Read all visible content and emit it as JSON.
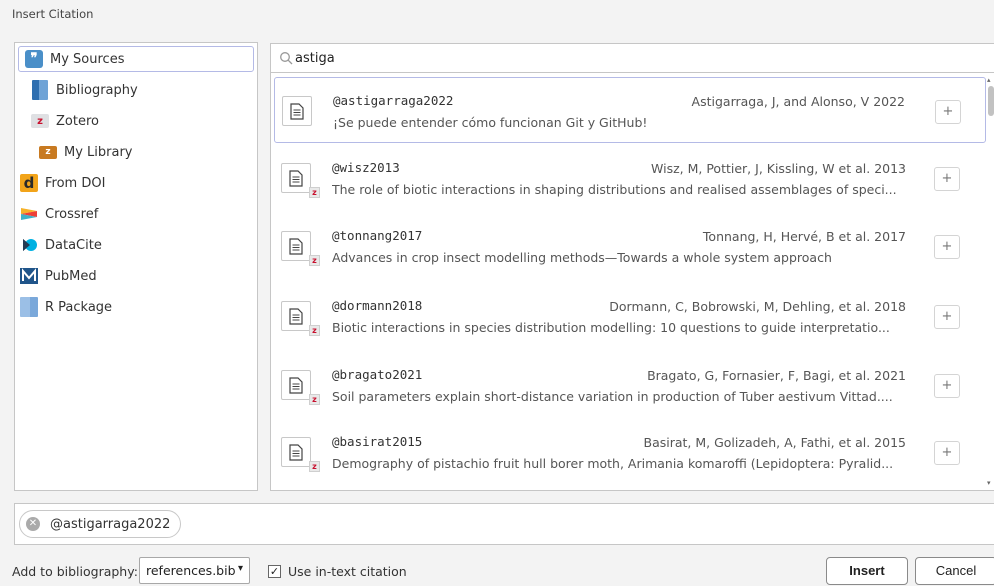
{
  "window": {
    "title": "Insert Citation"
  },
  "sidebar": {
    "items": [
      {
        "label": "My Sources",
        "icon": "quote-bubble-icon",
        "selected": true
      },
      {
        "label": "Bibliography",
        "icon": "book-icon"
      },
      {
        "label": "Zotero",
        "icon": "zotero-icon"
      },
      {
        "label": "My Library",
        "icon": "library-folder-icon"
      },
      {
        "label": "From DOI",
        "icon": "doi-icon"
      },
      {
        "label": "Crossref",
        "icon": "crossref-icon"
      },
      {
        "label": "DataCite",
        "icon": "datacite-icon"
      },
      {
        "label": "PubMed",
        "icon": "pubmed-icon"
      },
      {
        "label": "R Package",
        "icon": "package-icon"
      }
    ]
  },
  "search": {
    "value": "astiga",
    "icon": "search-icon"
  },
  "results": [
    {
      "key": "@astigarraga2022",
      "authors": "Astigarraga, J, and Alonso, V 2022",
      "title": "¡Se puede entender cómo funcionan Git y GitHub!",
      "zotero": false,
      "selected": true,
      "add": "+"
    },
    {
      "key": "@wisz2013",
      "authors": "Wisz, M, Pottier, J, Kissling, W et al. 2013",
      "title": "The role of biotic interactions in shaping distributions and realised assemblages of speci...",
      "zotero": true,
      "add": "+"
    },
    {
      "key": "@tonnang2017",
      "authors": "Tonnang, H, Hervé, B et al. 2017",
      "title": "Advances in crop insect modelling methods—Towards a whole system approach",
      "zotero": true,
      "add": "+"
    },
    {
      "key": "@dormann2018",
      "authors": "Dormann, C, Bobrowski, M, Dehling, et al. 2018",
      "title": "Biotic interactions in species distribution modelling: 10 questions to guide interpretatio...",
      "zotero": true,
      "add": "+"
    },
    {
      "key": "@bragato2021",
      "authors": "Bragato, G, Fornasier, F, Bagi, et al. 2021",
      "title": "Soil parameters explain short-distance variation in production of Tuber aestivum Vittad....",
      "zotero": true,
      "add": "+"
    },
    {
      "key": "@basirat2015",
      "authors": "Basirat, M, Golizadeh, A, Fathi, et al. 2015",
      "title": "Demography of pistachio fruit hull borer moth, Arimania komaroffi (Lepidoptera: Pyralid...",
      "zotero": true,
      "add": "+"
    }
  ],
  "selected_citations": [
    {
      "label": "@astigarraga2022"
    }
  ],
  "bottom": {
    "add_to_bibliography_label": "Add to bibliography:",
    "bibliography_file": "references.bib",
    "use_in_text_label": "Use in-text citation",
    "use_in_text_checked": true,
    "check_mark": "✓",
    "dropdown_caret": "▾",
    "insert_label": "Insert",
    "cancel_label": "Cancel"
  }
}
